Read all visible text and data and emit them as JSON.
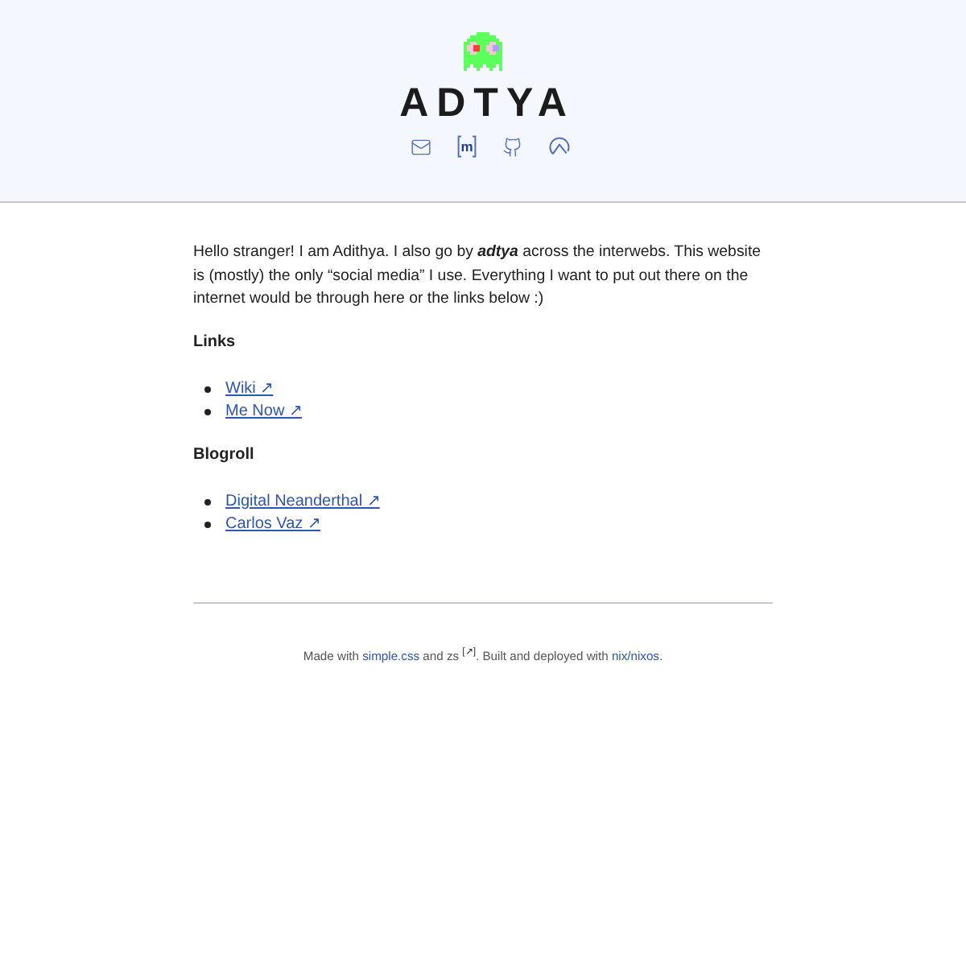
{
  "header": {
    "title": "ADTYA",
    "icons": [
      {
        "kind": "mail"
      },
      {
        "kind": "brackets",
        "letter": "m"
      },
      {
        "kind": "github"
      },
      {
        "kind": "peak"
      }
    ]
  },
  "intro": "Hello stranger! I am Adithya. I also go by **adtya** across the interwebs. This website is (mostly) the only “social media” I use. Everything I want to put out there on the internet would be through here or the links below :)",
  "sections": [
    {
      "heading": "Links",
      "links": [
        "Wiki ↗",
        "Me Now ↗"
      ]
    },
    {
      "heading": "Blogroll",
      "links": [
        "Digital Neanderthal ↗",
        "Carlos Vaz ↗"
      ]
    }
  ],
  "footer": {
    "parts": [
      {
        "kind": "text",
        "text": "Made with "
      },
      {
        "kind": "link",
        "text": "simple.css"
      },
      {
        "kind": "text",
        "text": " and zs "
      },
      {
        "kind": "sup_link",
        "text": "[↗]"
      },
      {
        "kind": "text",
        "text": ". Built and deployed with "
      },
      {
        "kind": "link",
        "text": "nix/nixos"
      },
      {
        "kind": "text",
        "text": "."
      }
    ]
  }
}
